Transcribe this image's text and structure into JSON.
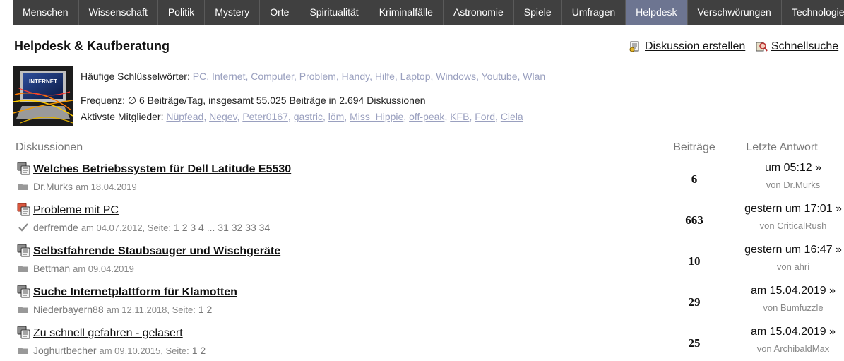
{
  "nav": {
    "items": [
      "Menschen",
      "Wissenschaft",
      "Politik",
      "Mystery",
      "Orte",
      "Spiritualität",
      "Kriminalfälle",
      "Astronomie",
      "Spiele",
      "Umfragen",
      "Helpdesk",
      "Verschwörungen",
      "Technologie"
    ],
    "active": "Helpdesk"
  },
  "header": {
    "title": "Helpdesk & Kaufberatung",
    "create_label": "Diskussion erstellen",
    "search_label": "Schnellsuche"
  },
  "thumbnail": {
    "text": "INTERNET"
  },
  "info": {
    "keywords_label": "Häufige Schlüsselwörter:",
    "keywords": [
      "PC",
      "Internet",
      "Computer",
      "Problem",
      "Handy",
      "Hilfe",
      "Laptop",
      "Windows",
      "Youtube",
      "Wlan"
    ],
    "frequency": "Frequenz: ∅ 6 Beiträge/Tag, insgesamt 55.025 Beiträge in 2.694 Diskussionen",
    "members_label": "Aktivste Mitglieder:",
    "members": [
      "Nüpfead",
      "Negev",
      "Peter0167",
      "gastric",
      "löm",
      "Miss_Hippie",
      "off-peak",
      "KFB",
      "Ford",
      "Ciela"
    ]
  },
  "table": {
    "col_discussions": "Diskussionen",
    "col_posts": "Beiträge",
    "col_last": "Letzte Antwort",
    "rows": [
      {
        "title": "Welches Betriebssystem für Dell Latitude E5530",
        "bold": true,
        "hot": false,
        "meta_icon": "folder-icon",
        "author": "Dr.Murks",
        "date": "am 18.04.2019",
        "pages": "",
        "posts": "6",
        "last": "um 05:12 »",
        "by": "von Dr.Murks"
      },
      {
        "title": "Probleme mit PC",
        "bold": false,
        "hot": true,
        "meta_icon": "check-icon",
        "author": "derfremde",
        "date": "am 04.07.2012, Seite:",
        "pages": "1 2 3 4 ... 31 32 33 34",
        "posts": "663",
        "last": "gestern um 17:01 »",
        "by": "von CriticalRush"
      },
      {
        "title": "Selbstfahrende Staubsauger und Wischgeräte",
        "bold": true,
        "hot": false,
        "meta_icon": "folder-icon",
        "author": "Bettman",
        "date": "am 09.04.2019",
        "pages": "",
        "posts": "10",
        "last": "gestern um 16:47 »",
        "by": "von ahri"
      },
      {
        "title": "Suche Internetplattform für Klamotten",
        "bold": true,
        "hot": false,
        "meta_icon": "folder-icon",
        "author": "Niederbayern88",
        "date": "am 12.11.2018, Seite:",
        "pages": "1 2",
        "posts": "29",
        "last": "am 15.04.2019 »",
        "by": "von Bumfuzzle"
      },
      {
        "title": "Zu schnell gefahren - gelasert",
        "bold": false,
        "hot": false,
        "meta_icon": "folder-icon",
        "author": "Joghurtbecher",
        "date": "am 09.10.2015, Seite:",
        "pages": "1 2",
        "posts": "25",
        "last": "am 15.04.2019 »",
        "by": "von ArchibaldMax"
      }
    ]
  }
}
